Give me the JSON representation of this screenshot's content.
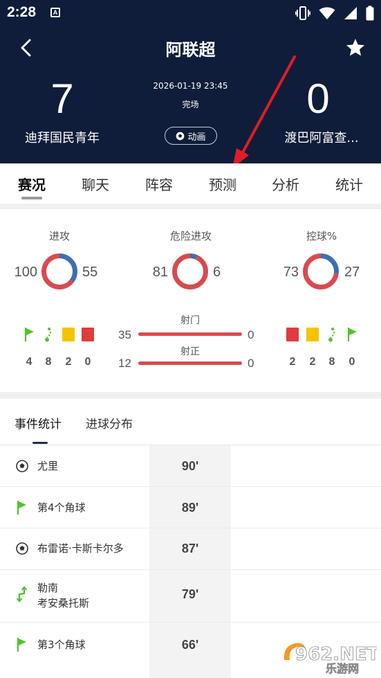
{
  "status_bar": {
    "time": "2:28",
    "notif_letter": "A"
  },
  "header": {
    "title": "阿联超",
    "datetime": "2026-01-19 23:45",
    "status": "完场",
    "animation_label": "动画",
    "home": {
      "name": "迪拜国民青年",
      "score": "7"
    },
    "away": {
      "name": "渡巴阿富查...",
      "score": "0"
    }
  },
  "tabs": [
    {
      "label": "赛况",
      "active": true
    },
    {
      "label": "聊天"
    },
    {
      "label": "阵容"
    },
    {
      "label": "预测"
    },
    {
      "label": "分析"
    },
    {
      "label": "统计"
    }
  ],
  "stats": {
    "metrics": [
      {
        "label": "进攻",
        "home": 100,
        "away": 55
      },
      {
        "label": "危险进攻",
        "home": 81,
        "away": 6
      },
      {
        "label": "控球%",
        "home": 73,
        "away": 27
      }
    ],
    "home_counts": {
      "corners": "4",
      "substitutions": "8",
      "yellow_cards": "2",
      "red_cards": "0"
    },
    "away_counts": {
      "red_cards": "2",
      "yellow_cards": "2",
      "substitutions": "8",
      "corners": "0"
    },
    "bars": [
      {
        "label": "射门",
        "home": "35",
        "away": "0",
        "home_share": 1.0
      },
      {
        "label": "射正",
        "home": "12",
        "away": "0",
        "home_share": 1.0
      }
    ],
    "colors": {
      "home": "#d94a4f",
      "away": "#3d6fb3",
      "corner": "#55c22a",
      "yellow": "#f5c400",
      "red": "#e03c3c"
    }
  },
  "events": {
    "tabs": [
      "事件统计",
      "进球分布"
    ],
    "rows": [
      {
        "icon": "football-icon",
        "text": "尤里",
        "text2": "",
        "minute": "90'"
      },
      {
        "icon": "corner-flag-icon",
        "text": "第4个角球",
        "text2": "",
        "minute": "89'"
      },
      {
        "icon": "football-icon",
        "text": "布雷诺·卡斯卡尔多",
        "text2": "",
        "minute": "87'"
      },
      {
        "icon": "substitution-icon",
        "text": "勒南",
        "text2": "考安桑托斯",
        "minute": "79'"
      },
      {
        "icon": "corner-flag-icon",
        "text": "第3个角球",
        "text2": "",
        "minute": "66'"
      }
    ]
  },
  "watermark": {
    "brand": "962.NET",
    "sub": "乐游网"
  }
}
